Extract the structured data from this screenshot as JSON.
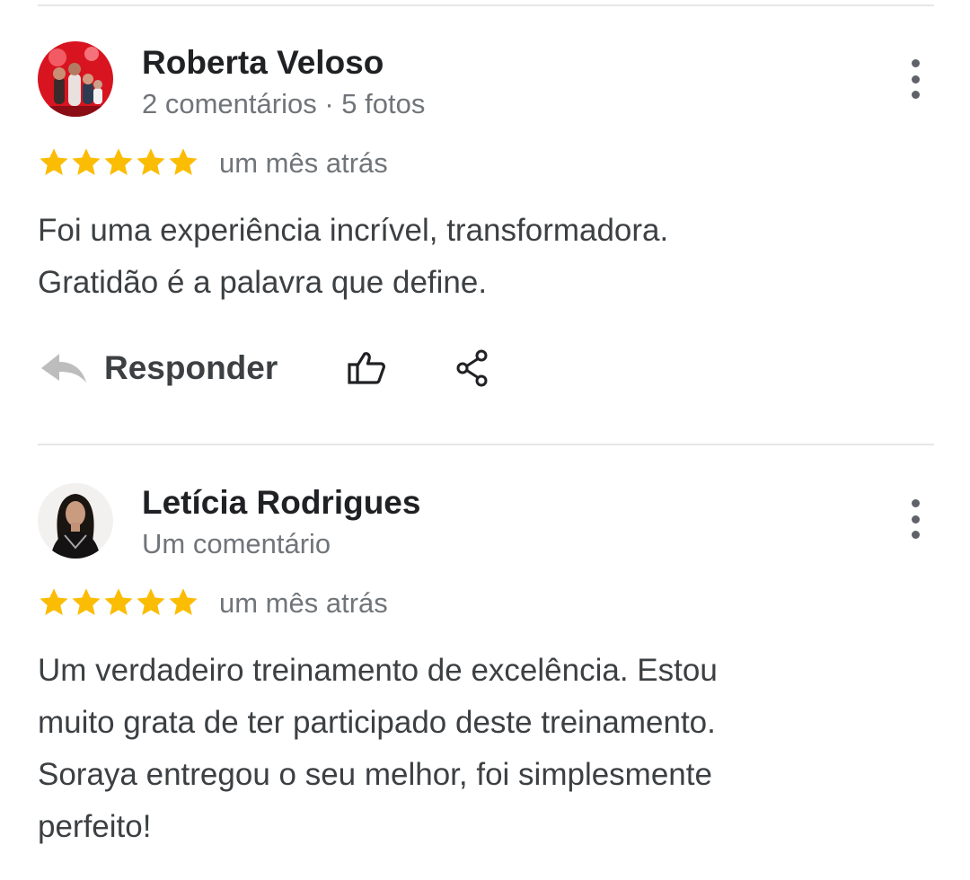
{
  "reviews": [
    {
      "name": "Roberta Veloso",
      "meta": "2 comentários · 5 fotos",
      "rating": 5,
      "when": "um mês atrás",
      "text_lines": [
        "Foi uma experiência incrível, transformadora.",
        "Gratidão é a palavra que define."
      ],
      "reply_label": "Responder",
      "avatar_icon": "profile-photo-family",
      "more_icon": "more-vertical-icon"
    },
    {
      "name": "Letícia Rodrigues",
      "meta": "Um comentário",
      "rating": 5,
      "when": "um mês atrás",
      "text_lines": [
        "Um verdadeiro treinamento de excelência. Estou",
        "muito grata de ter participado deste treinamento.",
        "Soraya entregou o seu melhor, foi simplesmente",
        "perfeito!"
      ],
      "avatar_icon": "profile-photo-woman",
      "more_icon": "more-vertical-icon"
    }
  ],
  "icons": {
    "reply": "reply-icon",
    "like": "thumbs-up-icon",
    "share": "share-icon",
    "star": "star-icon"
  },
  "colors": {
    "star": "#fbbc04",
    "name": "#202124",
    "meta": "#70757a",
    "text": "#3c4043",
    "divider": "#e6e6e6"
  }
}
